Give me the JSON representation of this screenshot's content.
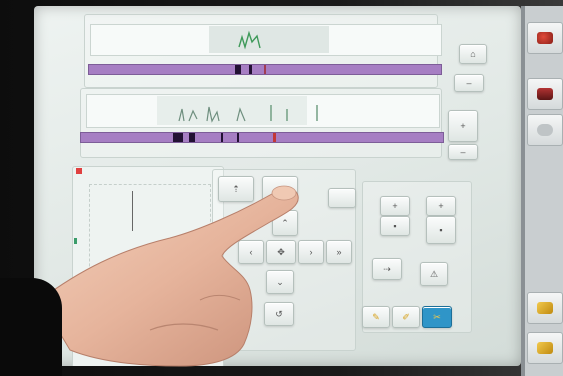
{
  "graph_panel": {
    "title": "",
    "axis_label": ""
  },
  "controls": {
    "small_button_label": "",
    "mid_label_left": "",
    "mid_label_right": ""
  },
  "right_panel": {
    "items": [
      {
        "icon": "paint-icon",
        "label": ""
      },
      {
        "icon": "print-icon",
        "label": ""
      },
      {
        "icon": "folder-icon",
        "label": ""
      },
      {
        "icon": "thread-icon",
        "label": ""
      },
      {
        "icon": "needle-icon",
        "label": ""
      }
    ]
  },
  "colors": {
    "lane": "#a67ec3",
    "highlight": "#2f95c8",
    "indicator": "#e04040"
  }
}
